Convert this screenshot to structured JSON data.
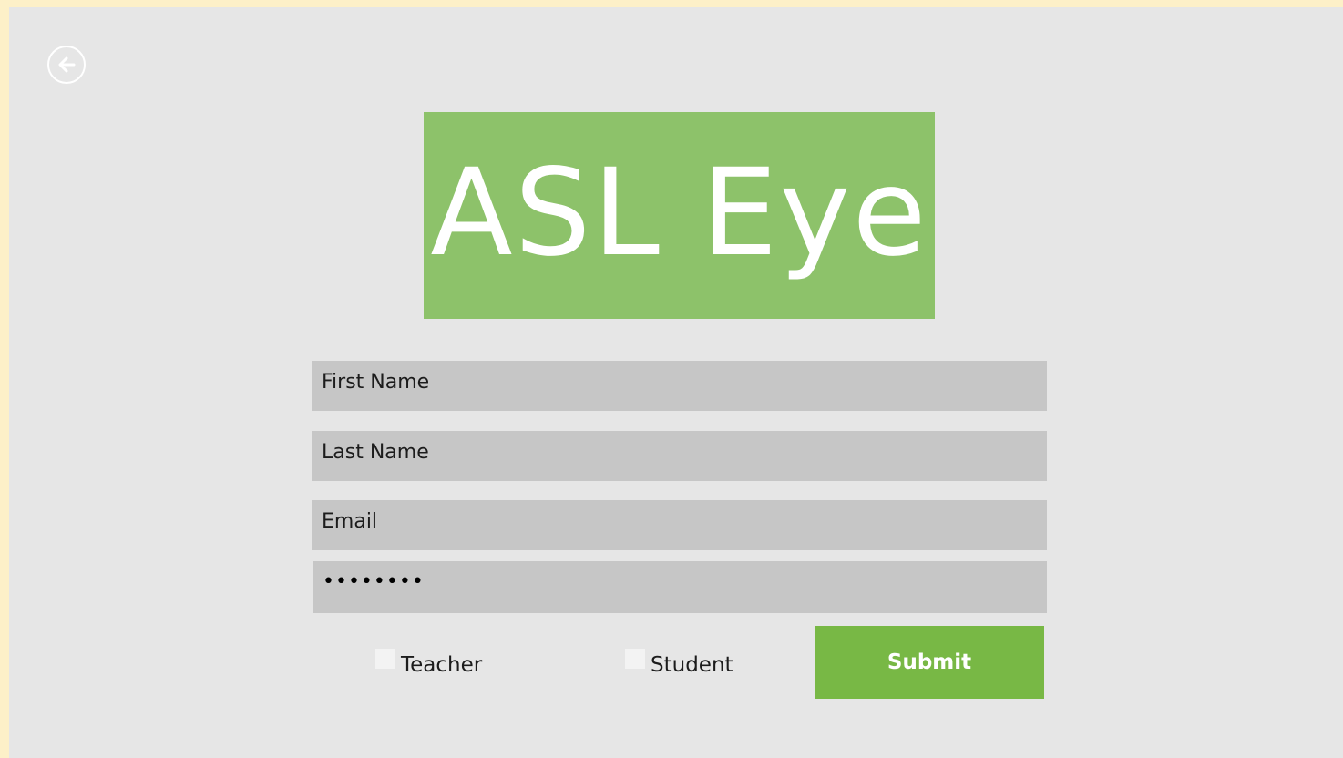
{
  "app": {
    "logo_text": "ASL Eye",
    "back_icon": "arrow-left-circle-icon"
  },
  "form": {
    "first_name": {
      "value": "",
      "placeholder": "First Name"
    },
    "last_name": {
      "value": "",
      "placeholder": "Last Name"
    },
    "email": {
      "value": "",
      "placeholder": "Email"
    },
    "password": {
      "masked_display": "••••••••"
    },
    "roles": [
      {
        "label": "Teacher",
        "checked": false
      },
      {
        "label": "Student",
        "checked": false
      }
    ],
    "submit_label": "Submit"
  },
  "colors": {
    "logo_background": "#8dc26a",
    "submit_background": "#78b845",
    "page_background": "#e6e6e6",
    "field_background": "#c6c6c6"
  }
}
